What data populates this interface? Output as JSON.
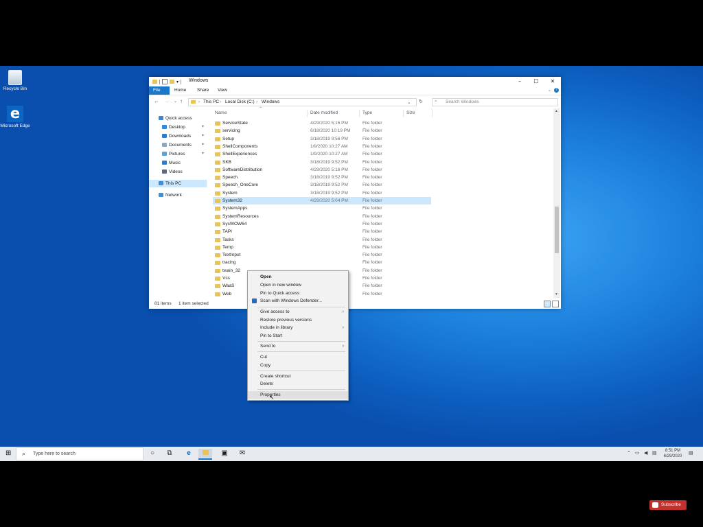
{
  "desktop": {
    "icons": [
      {
        "label": "Recycle Bin",
        "icon": "recycle-bin-icon"
      },
      {
        "label": "Microsoft Edge",
        "icon": "edge-icon"
      }
    ]
  },
  "explorer": {
    "title": "Windows",
    "ribbon_tabs": [
      "File",
      "Home",
      "Share",
      "View"
    ],
    "breadcrumb": [
      "This PC",
      "Local Disk (C:)",
      "Windows"
    ],
    "search_placeholder": "Search Windows",
    "nav_items": [
      {
        "label": "Quick access",
        "icon": "star-icon",
        "pinned": false
      },
      {
        "label": "Desktop",
        "icon": "desktop-icon",
        "pinned": true
      },
      {
        "label": "Downloads",
        "icon": "download-icon",
        "pinned": true
      },
      {
        "label": "Documents",
        "icon": "documents-icon",
        "pinned": true
      },
      {
        "label": "Pictures",
        "icon": "pictures-icon",
        "pinned": true
      },
      {
        "label": "Music",
        "icon": "music-icon",
        "pinned": false
      },
      {
        "label": "Videos",
        "icon": "videos-icon",
        "pinned": false
      },
      {
        "label": "This PC",
        "icon": "computer-icon",
        "pinned": false
      },
      {
        "label": "Network",
        "icon": "network-icon",
        "pinned": false
      }
    ],
    "columns": [
      "Name",
      "Date modified",
      "Type",
      "Size"
    ],
    "rows": [
      {
        "name": "ServiceState",
        "date": "4/29/2020 5:15 PM",
        "type": "File folder"
      },
      {
        "name": "servicing",
        "date": "6/18/2020 10:19 PM",
        "type": "File folder"
      },
      {
        "name": "Setup",
        "date": "3/18/2019 9:56 PM",
        "type": "File folder"
      },
      {
        "name": "ShellComponents",
        "date": "1/9/2020 10:27 AM",
        "type": "File folder"
      },
      {
        "name": "ShellExperiences",
        "date": "1/9/2020 10:27 AM",
        "type": "File folder"
      },
      {
        "name": "SKB",
        "date": "3/18/2019 9:52 PM",
        "type": "File folder"
      },
      {
        "name": "SoftwareDistribution",
        "date": "4/29/2020 5:16 PM",
        "type": "File folder"
      },
      {
        "name": "Speech",
        "date": "3/18/2019 9:52 PM",
        "type": "File folder"
      },
      {
        "name": "Speech_OneCore",
        "date": "3/18/2019 9:52 PM",
        "type": "File folder"
      },
      {
        "name": "System",
        "date": "3/18/2019 9:52 PM",
        "type": "File folder"
      },
      {
        "name": "System32",
        "date": "4/29/2020 5:04 PM",
        "type": "File folder"
      },
      {
        "name": "SystemApps",
        "date": "",
        "type": "File folder"
      },
      {
        "name": "SystemResources",
        "date": "",
        "type": "File folder"
      },
      {
        "name": "SysWOW64",
        "date": "",
        "type": "File folder"
      },
      {
        "name": "TAPI",
        "date": "",
        "type": "File folder"
      },
      {
        "name": "Tasks",
        "date": "",
        "type": "File folder"
      },
      {
        "name": "Temp",
        "date": "",
        "type": "File folder"
      },
      {
        "name": "TextInput",
        "date": "",
        "type": "File folder"
      },
      {
        "name": "tracing",
        "date": "",
        "type": "File folder"
      },
      {
        "name": "twain_32",
        "date": "",
        "type": "File folder"
      },
      {
        "name": "Vss",
        "date": "",
        "type": "File folder"
      },
      {
        "name": "WaaS",
        "date": "",
        "type": "File folder"
      },
      {
        "name": "Web",
        "date": "",
        "type": "File folder"
      }
    ],
    "selected_row": "System32",
    "status_items": "81 items",
    "status_selected": "1 item selected"
  },
  "context_menu": {
    "items": [
      {
        "label": "Open",
        "bold": true,
        "submenu": false,
        "icon": ""
      },
      {
        "label": "Open in new window",
        "submenu": false,
        "icon": ""
      },
      {
        "label": "Pin to Quick access",
        "submenu": false,
        "icon": ""
      },
      {
        "label": "Scan with Windows Defender...",
        "submenu": false,
        "icon": "defender-shield-icon"
      },
      {
        "separator": true
      },
      {
        "label": "Give access to",
        "submenu": true,
        "icon": ""
      },
      {
        "label": "Restore previous versions",
        "submenu": false,
        "icon": ""
      },
      {
        "label": "Include in library",
        "submenu": true,
        "icon": ""
      },
      {
        "label": "Pin to Start",
        "submenu": false,
        "icon": ""
      },
      {
        "separator": true
      },
      {
        "label": "Send to",
        "submenu": true,
        "icon": ""
      },
      {
        "separator": true
      },
      {
        "label": "Cut",
        "submenu": false,
        "icon": ""
      },
      {
        "label": "Copy",
        "submenu": false,
        "icon": ""
      },
      {
        "separator": true
      },
      {
        "label": "Create shortcut",
        "submenu": false,
        "icon": ""
      },
      {
        "label": "Delete",
        "submenu": false,
        "icon": ""
      },
      {
        "separator": true
      },
      {
        "label": "Properties",
        "submenu": false,
        "icon": ""
      }
    ]
  },
  "taskbar": {
    "search_placeholder": "Type here to search",
    "pinned_icons": [
      "cortana-icon",
      "task-view-icon",
      "edge-icon",
      "file-explorer-icon",
      "store-icon",
      "mail-icon"
    ],
    "tray_icons": [
      "chevron-up-icon",
      "network-icon",
      "volume-icon",
      "notification-icon"
    ],
    "clock_time": "8:51 PM",
    "clock_date": "6/29/2020"
  },
  "overlay": {
    "subscribe_label": "Subscribe"
  },
  "colors": {
    "desktop_blue": "#1d82de",
    "accent": "#1979ca",
    "selection": "#cce8ff",
    "folder": "#e9c25a",
    "subscribe_red": "#c4302b"
  }
}
